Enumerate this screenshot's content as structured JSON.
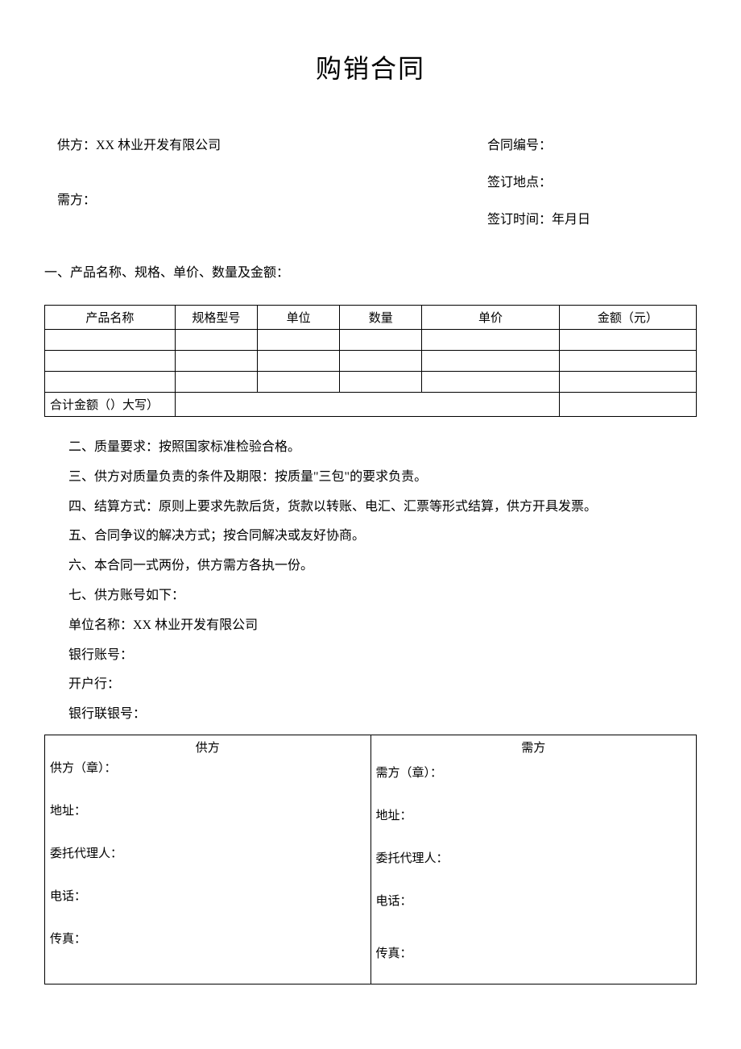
{
  "title": "购销合同",
  "header": {
    "supplier_label": "供方：XX 林业开发有限公司",
    "buyer_label": "需方：",
    "contract_no_label": "合同编号：",
    "sign_place_label": "签订地点：",
    "sign_time_label": "签订时间：年月日"
  },
  "section1_intro": "一、产品名称、规格、单价、数量及金额：",
  "product_table": {
    "headers": [
      "产品名称",
      "规格型号",
      "单位",
      "数量",
      "单价",
      "金额（元）"
    ],
    "rows": [
      [
        "",
        "",
        "",
        "",
        "",
        ""
      ],
      [
        "",
        "",
        "",
        "",
        "",
        ""
      ],
      [
        "",
        "",
        "",
        "",
        "",
        ""
      ]
    ],
    "footer_label": "合计金额（）大写）"
  },
  "clauses": [
    "二、质量要求：按照国家标准检验合格。",
    "三、供方对质量负责的条件及期限：按质量\"三包\"的要求负责。",
    "四、结算方式：原则上要求先款后货，货款以转账、电汇、汇票等形式结算，供方开具发票。",
    "五、合同争议的解决方式；按合同解决或友好协商。",
    "六、本合同一式两份，供方需方各执一份。",
    "七、供方账号如下：",
    "单位名称：XX 林业开发有限公司",
    "银行账号：",
    "开户行：",
    "银行联银号："
  ],
  "sign_table": {
    "supplier_header": "供方",
    "buyer_header": "需方",
    "supplier_lines": [
      "供方（章）：",
      "地址：",
      "委托代理人：",
      "电话：",
      "传真："
    ],
    "buyer_lines": [
      "需方（章）：",
      "地址：",
      "委托代理人：",
      "电话：",
      "传真："
    ]
  }
}
